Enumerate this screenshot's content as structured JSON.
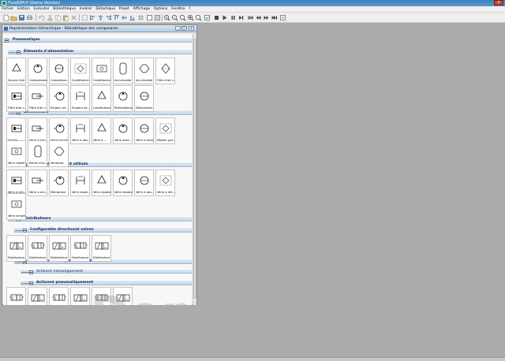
{
  "window": {
    "title": "FluidSIM-P (Demo Version)",
    "close_label": "x"
  },
  "menubar": {
    "items": [
      "Fichier",
      "Edition",
      "Exécuter",
      "Bibliothèque",
      "Insérer",
      "Didactique",
      "Projet",
      "Affichage",
      "Options",
      "Fenêtre",
      "?"
    ]
  },
  "toolbar": {
    "icons": [
      "new-icon",
      "open-icon",
      "save-icon",
      "print-icon",
      "undo-icon",
      "cut-icon",
      "copy-icon",
      "paste-icon",
      "delete-icon",
      "select-icon",
      "align-left-icon",
      "align-center-icon",
      "align-right-icon",
      "align-top-icon",
      "align-middle-icon",
      "align-bottom-icon",
      "grid-icon",
      "zoom-icon",
      "zoom-in-icon",
      "zoom-out-icon",
      "zoom-fit-icon",
      "zoom-window-icon",
      "zoom-previous-icon",
      "check-icon",
      "stop-icon",
      "play-icon",
      "pause-icon",
      "step-icon",
      "rewind-icon",
      "forward-icon",
      "end-icon",
      "reset-icon"
    ]
  },
  "library": {
    "title": "Représentation hiérarchique - Bibliothèque des composants",
    "buttons": {
      "minimize": "_",
      "maximize": "□",
      "close": "x"
    },
    "sections": {
      "pneumatique": "Pneumatique",
      "alimentation": "Eléments d'alimentation",
      "actionneurs": "Actionneurs",
      "verins": "Vérins fréquemment utilisés",
      "distributeurs": "Distributeurs",
      "configurable": "Configurable directional valves",
      "plus_souvent": "Distributeurs les plus souvent utilisés",
      "mecaniquement": "Actionné mécaniquement",
      "pneumatiquement": "Actionné pneumatiquement"
    },
    "alimentation_items": [
      "Source d'air",
      "Compresseur",
      "Compresse...",
      "Conditionne...",
      "Conditionne...",
      "Accumulate",
      "Accumulate",
      "Filtre d'air c...",
      "Filtre d'air c...",
      "Filtre d'air c...",
      "Purgeur de ...",
      "Purgeur de ...",
      "Lubrificateur",
      "Refroidisseur",
      "Déshydrate..."
    ],
    "actionneurs_items": [
      "Ventile",
      "Vérin à sim...",
      "Vérin simple...",
      "Vérin à dou...",
      "Vérin à ... ",
      "Vérin avec...",
      "Vérin à plusi...",
      "Moteur pne...",
      "Vérin rotatif",
      "Pointe d'as...",
      "Ventouse"
    ],
    "verins_items": [
      "Vérin à sim...",
      "Vérin à sim...",
      "Membrane",
      "Vérin doubl...",
      "Vérin double...",
      "Vérin double...",
      "Vérin à dou...",
      "Vérin à réd...",
      "Vérin simple..."
    ],
    "configurable_items": [
      "Distributeur",
      "Distributeur",
      "Distributeur",
      "Distributeur",
      "Distributeur"
    ],
    "pneumatiquement_items": [
      "Distributeur",
      "Distributeur",
      "Distributeur",
      "Distributeur",
      "Manuel, dis...",
      "Distributeur"
    ]
  },
  "watermark": "Demo"
}
